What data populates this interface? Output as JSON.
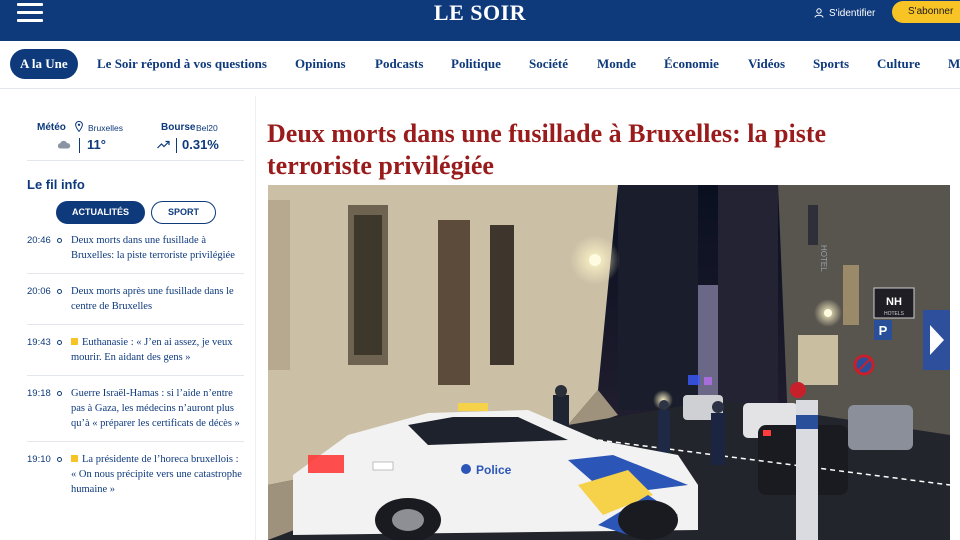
{
  "header": {
    "logo": "LE SOIR",
    "login_label": "S'identifier",
    "subscribe_label": "S'abonner"
  },
  "nav": {
    "items": [
      "A la Une",
      "Le Soir répond à vos questions",
      "Opinions",
      "Podcasts",
      "Politique",
      "Société",
      "Monde",
      "Économie",
      "Vidéos",
      "Sports",
      "Culture",
      "M"
    ]
  },
  "widgets": {
    "meteo_label": "Météo",
    "meteo_city": "Bruxelles",
    "meteo_value": "11°",
    "bourse_label": "Bourse",
    "bourse_index": "Bel20",
    "bourse_value": "0.31%"
  },
  "fil_info": {
    "title": "Le fil info",
    "tabs": [
      "ACTUALITÉS",
      "SPORT"
    ],
    "items": [
      {
        "time": "20:46",
        "premium": false,
        "text": "Deux morts dans une fusillade à Bruxelles: la piste terroriste privilégiée"
      },
      {
        "time": "20:06",
        "premium": false,
        "text": "Deux morts après une fusillade dans le centre de Bruxelles"
      },
      {
        "time": "19:43",
        "premium": true,
        "text": "Euthanasie : « J’en ai assez, je veux mourir. En aidant des gens »"
      },
      {
        "time": "19:18",
        "premium": false,
        "text": "Guerre Israël-Hamas : si l’aide n’entre pas à Gaza, les médecins n’auront plus qu’à « préparer les certificats de décès »"
      },
      {
        "time": "19:10",
        "premium": true,
        "text": "La présidente de l’horeca bruxellois : « On nous précipite vers une catastrophe humaine »"
      }
    ]
  },
  "main": {
    "headline": "Deux morts dans une fusillade à Bruxelles: la piste terroriste privilégiée",
    "hero": {
      "police_label": "Police",
      "hotel_sign": "NH",
      "hotel_sign_sub": "HOTELS",
      "parking_sign": "P",
      "vertical_sign": "HOTEL"
    }
  },
  "colors": {
    "brand_navy": "#0e3a7c",
    "accent_yellow": "#f7c325",
    "headline_red": "#9a1b1b"
  },
  "icons": {
    "menu": "hamburger-icon",
    "user": "user-icon",
    "location": "location-pin-icon",
    "weather": "cloud-icon",
    "trend": "trend-up-icon"
  }
}
